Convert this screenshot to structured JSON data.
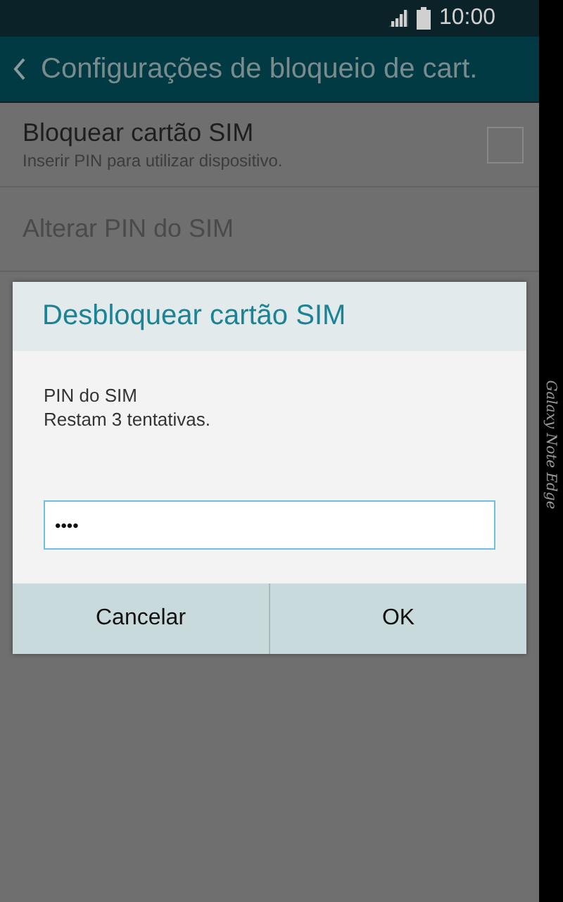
{
  "status_bar": {
    "time": "10:00"
  },
  "header": {
    "title": "Configurações de bloqueio de cart."
  },
  "settings": [
    {
      "kind": "checkbox",
      "title": "Bloquear cartão SIM",
      "subtitle": "Inserir PIN para utilizar dispositivo.",
      "checked": false,
      "disabled": false
    },
    {
      "kind": "plain",
      "title": "Alterar PIN do SIM",
      "disabled": true
    }
  ],
  "dialog": {
    "title": "Desbloquear cartão SIM",
    "message": [
      "PIN do SIM",
      "Restam 3 tentativas."
    ],
    "pin_value": "••••",
    "buttons": [
      "Cancelar",
      "OK"
    ]
  },
  "edge_panel": {
    "label": "Galaxy Note Edge"
  }
}
